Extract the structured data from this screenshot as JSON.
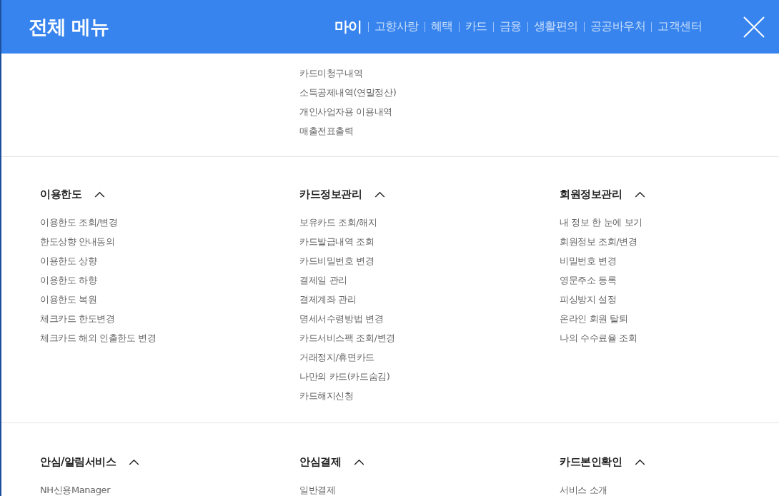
{
  "header": {
    "title": "전체 메뉴",
    "tabs": [
      {
        "label": "마이",
        "selected": true
      },
      {
        "label": "고향사랑",
        "selected": false
      },
      {
        "label": "혜택",
        "selected": false
      },
      {
        "label": "카드",
        "selected": false
      },
      {
        "label": "금융",
        "selected": false
      },
      {
        "label": "생활편의",
        "selected": false
      },
      {
        "label": "공공바우처",
        "selected": false
      },
      {
        "label": "고객센터",
        "selected": false
      }
    ]
  },
  "continued_column": {
    "items": [
      "카드미청구내역",
      "소득공제내역(연말정산)",
      "개인사업자용 이용내역",
      "매출전표출력"
    ]
  },
  "sections": [
    {
      "groups": [
        {
          "title": "이용한도",
          "expanded": true,
          "items": [
            "이용한도 조회/변경",
            "한도상향 안내동의",
            "이용한도 상향",
            "이용한도 하향",
            "이용한도 복원",
            "체크카드 한도변경",
            "체크카드 해외 인출한도 변경"
          ]
        },
        {
          "title": "카드정보관리",
          "expanded": true,
          "items": [
            "보유카드 조회/해지",
            "카드발급내역 조회",
            "카드비밀번호 변경",
            "결제일 관리",
            "결제계좌 관리",
            "명세서수령방법 변경",
            "카드서비스팩 조회/변경",
            "거래정지/휴면카드",
            "나만의 카드(카드숨김)",
            "카드해지신청"
          ]
        },
        {
          "title": "회원정보관리",
          "expanded": true,
          "items": [
            "내 정보 한 눈에 보기",
            "회원정보 조회/변경",
            "비밀번호 변경",
            "영문주소 등록",
            "피싱방지 설정",
            "온라인 회원 탈퇴",
            "나의 수수료율 조회"
          ]
        }
      ]
    },
    {
      "groups": [
        {
          "title": "안심/알림서비스",
          "expanded": true,
          "items": [
            "NH신용Manager"
          ]
        },
        {
          "title": "안심결제",
          "expanded": true,
          "items": [
            "일반결제"
          ]
        },
        {
          "title": "카드본인확인",
          "expanded": true,
          "items": [
            "서비스 소개"
          ]
        }
      ]
    }
  ]
}
